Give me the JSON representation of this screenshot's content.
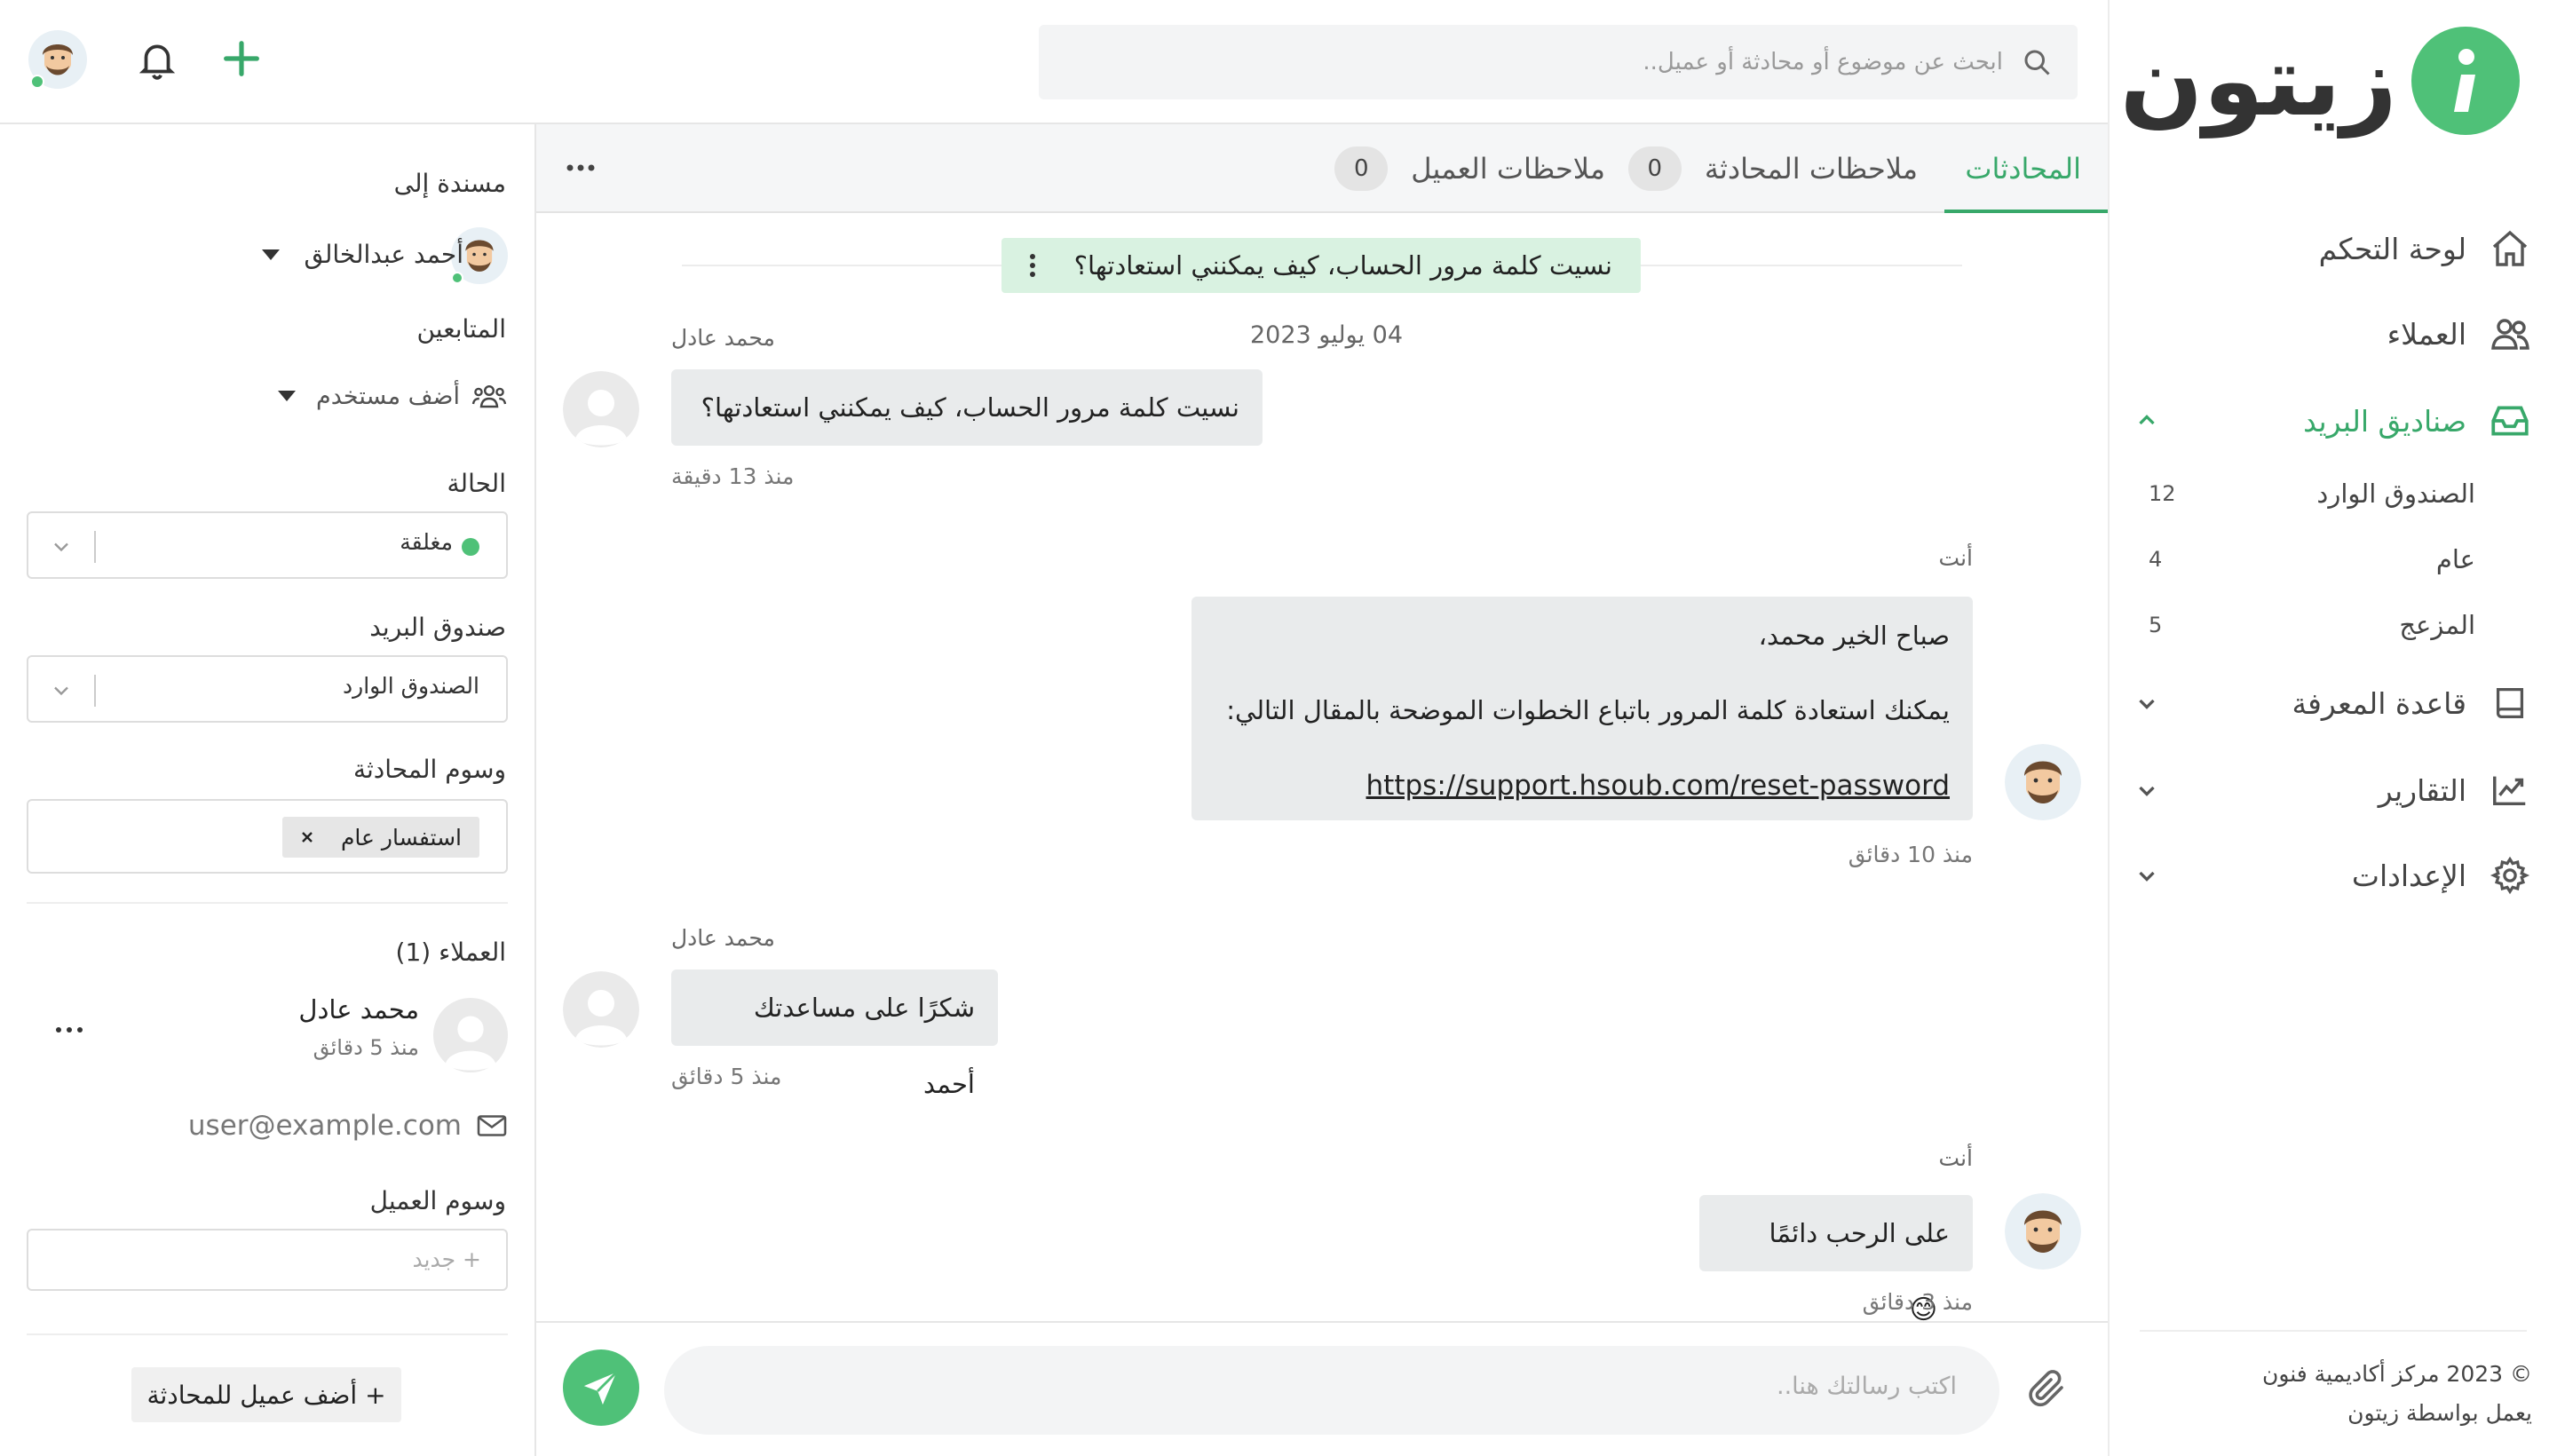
{
  "brand": {
    "name": "زيتون",
    "accent": "#4fc178",
    "accent_dark": "#38a86a"
  },
  "sidebar": {
    "items": [
      {
        "label": "لوحة التحكم",
        "icon": "home-icon"
      },
      {
        "label": "العملاء",
        "icon": "users-icon"
      },
      {
        "label": "صناديق البريد",
        "icon": "inbox-icon",
        "active": true,
        "expanded": true
      },
      {
        "label": "قاعدة المعرفة",
        "icon": "book-icon"
      },
      {
        "label": "التقارير",
        "icon": "chart-line-icon"
      },
      {
        "label": "الإعدادات",
        "icon": "gear-icon"
      }
    ],
    "mailboxes": [
      {
        "label": "الصندوق الوارد",
        "count": "12"
      },
      {
        "label": "عام",
        "count": "4"
      },
      {
        "label": "المزعج",
        "count": "5"
      }
    ],
    "footer": {
      "copyright": "© 2023 مركز أكاديمية فنون",
      "powered": "يعمل بواسطة زيتون"
    }
  },
  "topbar": {
    "search_placeholder": "ابحث عن موضوع أو محادثة أو عميل.."
  },
  "tabs": [
    {
      "label": "المحادثات",
      "active": true
    },
    {
      "label": "ملاحظات المحادثة",
      "count": "0"
    },
    {
      "label": "ملاحظات العميل",
      "count": "0"
    }
  ],
  "conversation": {
    "subject": "نسيت كلمة مرور الحساب، كيف يمكنني استعادتها؟",
    "date": "04 يوليو 2023",
    "messages": [
      {
        "sender": "محمد عادل",
        "text": "نسيت كلمة مرور الحساب، كيف يمكنني استعادتها؟",
        "time": "منذ 13 دقيقة"
      },
      {
        "sender": "أنت",
        "line1": "صباح الخير محمد،",
        "line2": "يمكنك استعادة كلمة المرور باتباع الخطوات الموضحة بالمقال التالي:",
        "link": "https://support.hsoub.com/reset-password",
        "time": "منذ 10 دقائق"
      },
      {
        "sender": "محمد عادل",
        "text": "شكرًا على مساعدتك أحمد",
        "time": "منذ 5 دقائق"
      },
      {
        "sender": "أنت",
        "text": "على الرحب دائمًا",
        "emoji": "😊",
        "time": "منذ 3 دقائق"
      }
    ],
    "composer_placeholder": "اكتب رسالتك هنا.."
  },
  "details": {
    "assigned_label": "مسندة إلى",
    "assignee": "أحمد عبدالخالق",
    "followers_label": "المتابعين",
    "add_user": "أضف مستخدم",
    "status_label": "الحالة",
    "status_value": "مغلقة",
    "status_color": "#4fc178",
    "mailbox_label": "صندوق البريد",
    "mailbox_value": "الصندوق الوارد",
    "conv_tags_label": "وسوم المحادثة",
    "conv_tag": "استفسار عام",
    "customers_label": "العملاء (1)",
    "customer_name": "محمد عادل",
    "customer_time": "منذ 5 دقائق",
    "customer_email": "user@example.com",
    "customer_tags_label": "وسوم العميل",
    "new_tag": "+ جديد",
    "add_customer": "+ أضف عميل للمحادثة"
  }
}
